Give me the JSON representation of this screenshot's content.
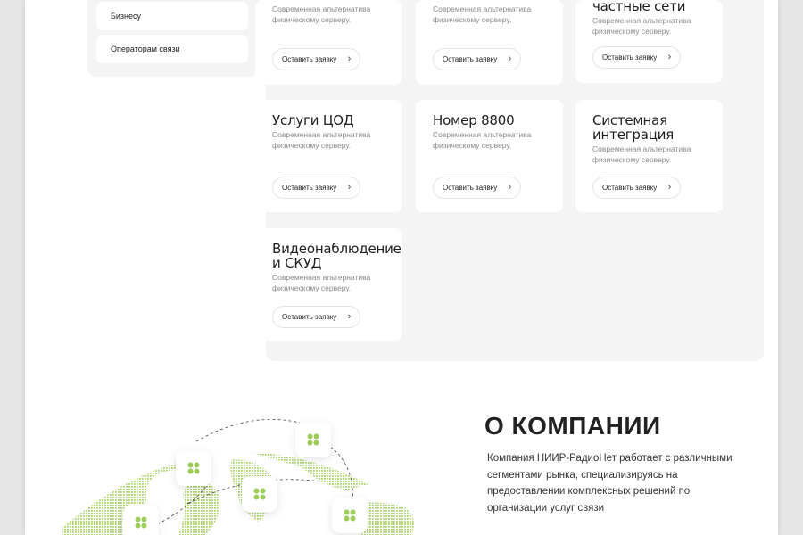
{
  "sidebar": {
    "items": [
      {
        "label": "Бизнесу"
      },
      {
        "label": "Операторам связи"
      }
    ]
  },
  "services": [
    {
      "title": "",
      "desc": "Современная альтернатива физическому серверу.",
      "button": "Оставить заявку"
    },
    {
      "title": "",
      "desc": "Современная альтернатива физическому серверу.",
      "button": "Оставить заявку"
    },
    {
      "title": "частные сети",
      "desc": "Современная альтернатива физическому серверу.",
      "button": "Оставить заявку"
    },
    {
      "title": "Услуги ЦОД",
      "desc": "Современная альтернатива физическому серверу.",
      "button": "Оставить заявку"
    },
    {
      "title": "Номер 8800",
      "desc": "Современная альтернатива физическому серверу.",
      "button": "Оставить заявку"
    },
    {
      "title": "Системная интеграция",
      "desc": "Современная альтернатива физическому серверу.",
      "button": "Оставить заявку"
    },
    {
      "title": "Видеонаблюдение и СКУД",
      "desc": "Современная альтернатива физическому серверу.",
      "button": "Оставить заявку"
    }
  ],
  "about": {
    "title": "О КОМПАНИИ",
    "text": "Компания НИИР-РадиоНет работает с различными сегментами рынка, специализируясь на предоставлении комплексных решений по организации услуг связи"
  },
  "icons": {
    "chevron": "chevron-right-icon",
    "map_marker": "clover-icon"
  },
  "colors": {
    "accent": "#9ccc5a",
    "card_bg": "#ffffff",
    "panel_bg": "#f4f4f4"
  }
}
